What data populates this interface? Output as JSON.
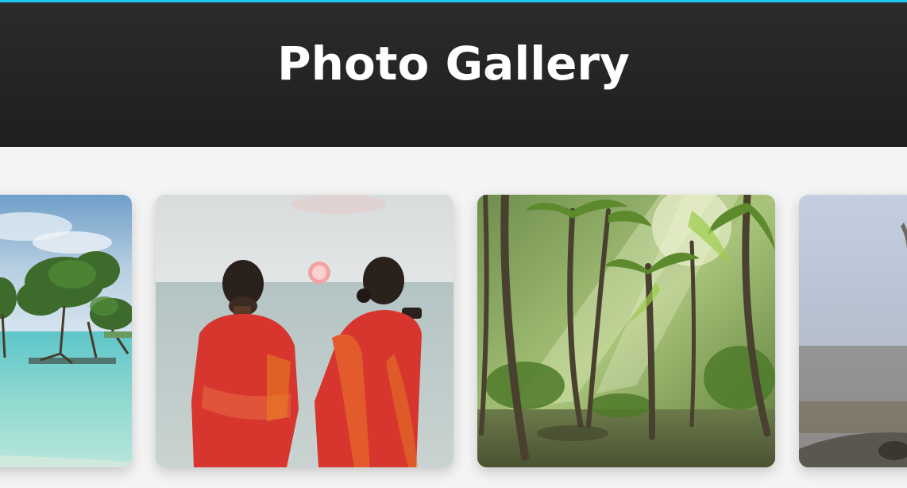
{
  "header": {
    "title": "Photo Gallery",
    "accent_color": "#1ec8f0",
    "background_color": "#262626"
  },
  "gallery": {
    "photos": [
      {
        "subject": "mangrove-beach",
        "icon": "mangrove-beach-photo"
      },
      {
        "subject": "two-women-sunset-sea",
        "icon": "sunset-women-photo"
      },
      {
        "subject": "palm-forest-sunbeams",
        "icon": "palm-forest-photo"
      },
      {
        "subject": "misty-hilltop",
        "icon": "misty-hill-photo"
      }
    ]
  }
}
